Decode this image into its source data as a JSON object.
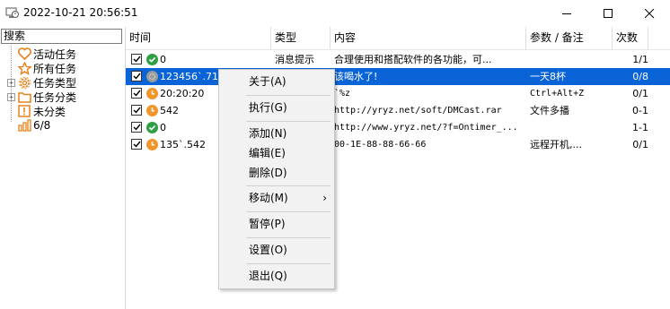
{
  "window": {
    "title": "2022-10-21 20:56:51"
  },
  "sidebar": {
    "search_label": "搜索",
    "items": [
      {
        "label": "活动任务",
        "icon": "heart-icon",
        "expandable": false,
        "color": "#e8801a"
      },
      {
        "label": "所有任务",
        "icon": "star-icon",
        "expandable": false,
        "color": "#e8801a"
      },
      {
        "label": "任务类型",
        "icon": "gear-icon",
        "expandable": true,
        "color": "#e8801a"
      },
      {
        "label": "任务分类",
        "icon": "folder-icon",
        "expandable": true,
        "color": "#e8801a"
      },
      {
        "label": "未分类",
        "icon": "exclamation-icon",
        "expandable": false,
        "color": "#e8801a"
      },
      {
        "label": "6/8",
        "icon": "bar-chart-icon",
        "expandable": false,
        "color": "#e8801a"
      }
    ]
  },
  "table": {
    "headers": [
      "时间",
      "类型",
      "内容",
      "参数 / 备注",
      "次数"
    ],
    "rows": [
      {
        "time": "0",
        "status": "ok",
        "type": "消息提示",
        "content": "合理使用和搭配软件的各功能，可...",
        "params": "",
        "count": "1/1",
        "selected": false
      },
      {
        "time": "123456`.714",
        "status": "disabled",
        "type": "消息提示",
        "content": "该喝水了!",
        "params": "一天8杯",
        "count": "0/8",
        "selected": true
      },
      {
        "time": "20:20:20",
        "status": "clock",
        "type": "",
        "content": "`%z",
        "params": "Ctrl+Alt+Z",
        "count": "0/1",
        "selected": false
      },
      {
        "time": "542",
        "status": "clock",
        "type": "",
        "content": "http://yryz.net/soft/DMCast.rar",
        "params": "文件多播",
        "count": "0-1",
        "selected": false
      },
      {
        "time": "0",
        "status": "ok",
        "type": "",
        "content": "http://www.yryz.net/?f=Ontimer_...",
        "params": "",
        "count": "1-1",
        "selected": false
      },
      {
        "time": "135`.542",
        "status": "clock",
        "type": "",
        "content": "00-1E-88-88-66-66",
        "params": "远程开机,...",
        "count": "0/1",
        "selected": false
      }
    ]
  },
  "context_menu": {
    "items": [
      {
        "label": "关于(A)",
        "submenu": false
      },
      {
        "label": "执行(G)",
        "submenu": false
      },
      {
        "label": "添加(N)",
        "submenu": false
      },
      {
        "label": "编辑(E)",
        "submenu": false
      },
      {
        "label": "删除(D)",
        "submenu": false
      },
      {
        "label": "移动(M)",
        "submenu": true
      },
      {
        "label": "暂停(P)",
        "submenu": false
      },
      {
        "label": "设置(O)",
        "submenu": false
      },
      {
        "label": "退出(Q)",
        "submenu": false
      }
    ],
    "submenu_arrow": "›"
  },
  "colors": {
    "selection": "#0a64d8",
    "accent_orange": "#f0962a",
    "ok_green": "#2ea043"
  }
}
